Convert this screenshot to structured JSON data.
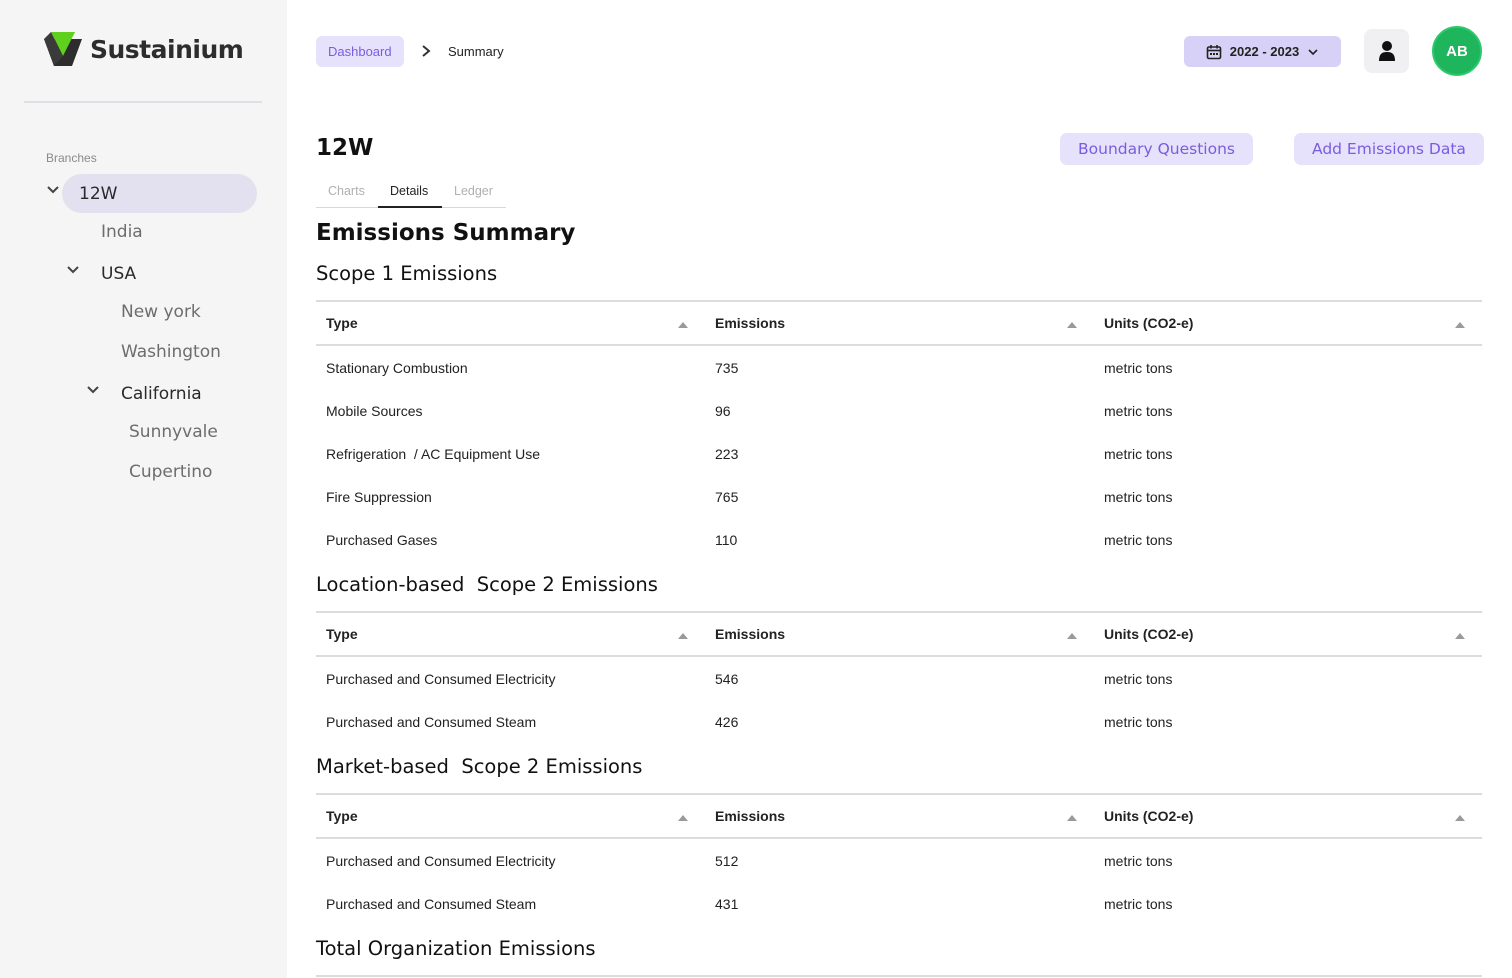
{
  "brand": {
    "name": "Sustainium",
    "logo_colors": [
      "#5fd01d",
      "#2d2d2d"
    ]
  },
  "sidebar": {
    "branches_label": "Branches",
    "tree": {
      "root": "12W",
      "india": "India",
      "usa": "USA",
      "new_york": "New york",
      "washington": "Washington",
      "california": "California",
      "sunnyvale": "Sunnyvale",
      "cupertino": "Cupertino"
    },
    "selected": "12W"
  },
  "header": {
    "breadcrumb": {
      "root": "Dashboard",
      "current": "Summary"
    },
    "year_range": "2022 - 2023",
    "avatar_initials": "AB",
    "icons": [
      "calendar-icon",
      "chevron-down-icon",
      "user-icon",
      "chevron-right-icon"
    ]
  },
  "page": {
    "title": "12W",
    "buttons": {
      "boundary": "Boundary Questions",
      "add": "Add Emissions Data"
    },
    "tabs": [
      "Charts",
      "Details",
      "Ledger"
    ],
    "active_tab": "Details",
    "summary_heading": "Emissions Summary"
  },
  "tables": [
    {
      "heading": "Scope 1 Emissions",
      "columns": [
        "Type",
        "Emissions",
        "Units (CO2-e)"
      ],
      "rows": [
        [
          "Stationary Combustion",
          "735",
          "metric tons"
        ],
        [
          "Mobile Sources",
          "96",
          "metric tons"
        ],
        [
          "Refrigeration  / AC Equipment Use",
          "223",
          "metric tons"
        ],
        [
          "Fire Suppression",
          "765",
          "metric tons"
        ],
        [
          "Purchased Gases",
          "110",
          "metric tons"
        ]
      ]
    },
    {
      "heading": "Location-based  Scope 2 Emissions",
      "columns": [
        "Type",
        "Emissions",
        "Units (CO2-e)"
      ],
      "rows": [
        [
          "Purchased and Consumed Electricity",
          "546",
          "metric tons"
        ],
        [
          "Purchased and Consumed Steam",
          "426",
          "metric tons"
        ]
      ]
    },
    {
      "heading": "Market-based  Scope 2 Emissions",
      "columns": [
        "Type",
        "Emissions",
        "Units (CO2-e)"
      ],
      "rows": [
        [
          "Purchased and Consumed Electricity",
          "512",
          "metric tons"
        ],
        [
          "Purchased and Consumed Steam",
          "431",
          "metric tons"
        ]
      ]
    }
  ],
  "total_heading": "Total Organization Emissions",
  "colors": {
    "accent": "#7a5ce0",
    "accent_bg": "#e6e2fb",
    "avatar": "#1fb55d",
    "sidebar_bg": "#f5f5f5"
  }
}
